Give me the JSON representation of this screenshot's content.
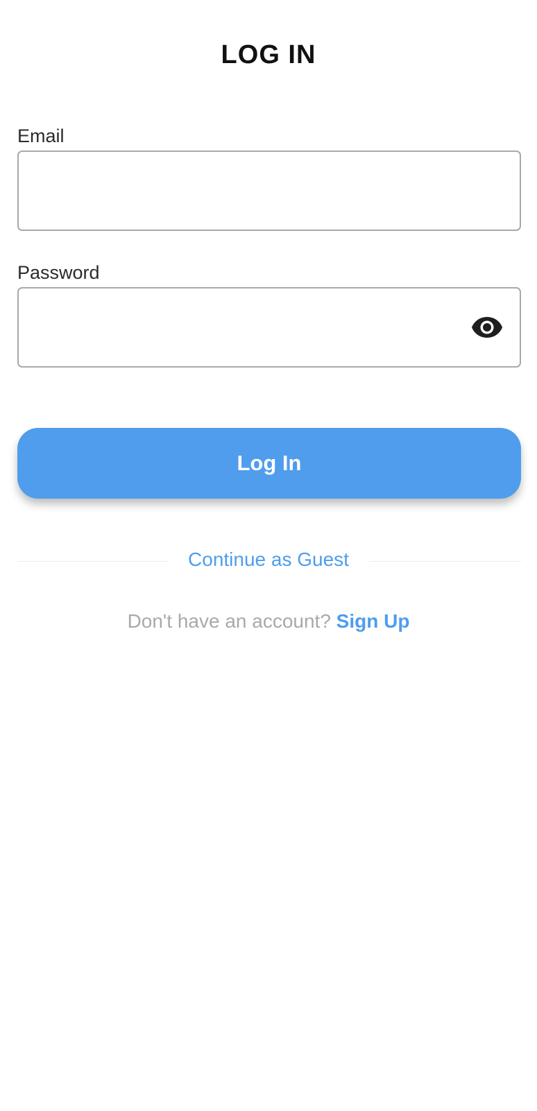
{
  "header": {
    "title": "LOG IN"
  },
  "form": {
    "email_label": "Email",
    "email_value": "",
    "password_label": "Password",
    "password_value": "",
    "password_toggle_icon": "eye-icon",
    "submit_label": "Log In"
  },
  "guest": {
    "label": "Continue as Guest"
  },
  "signup": {
    "prompt": "Don't have an account?",
    "link_label": "Sign Up"
  },
  "colors": {
    "accent": "#4f9dec",
    "input_border": "#a9a9a9",
    "muted_text": "#a9a9a9"
  }
}
